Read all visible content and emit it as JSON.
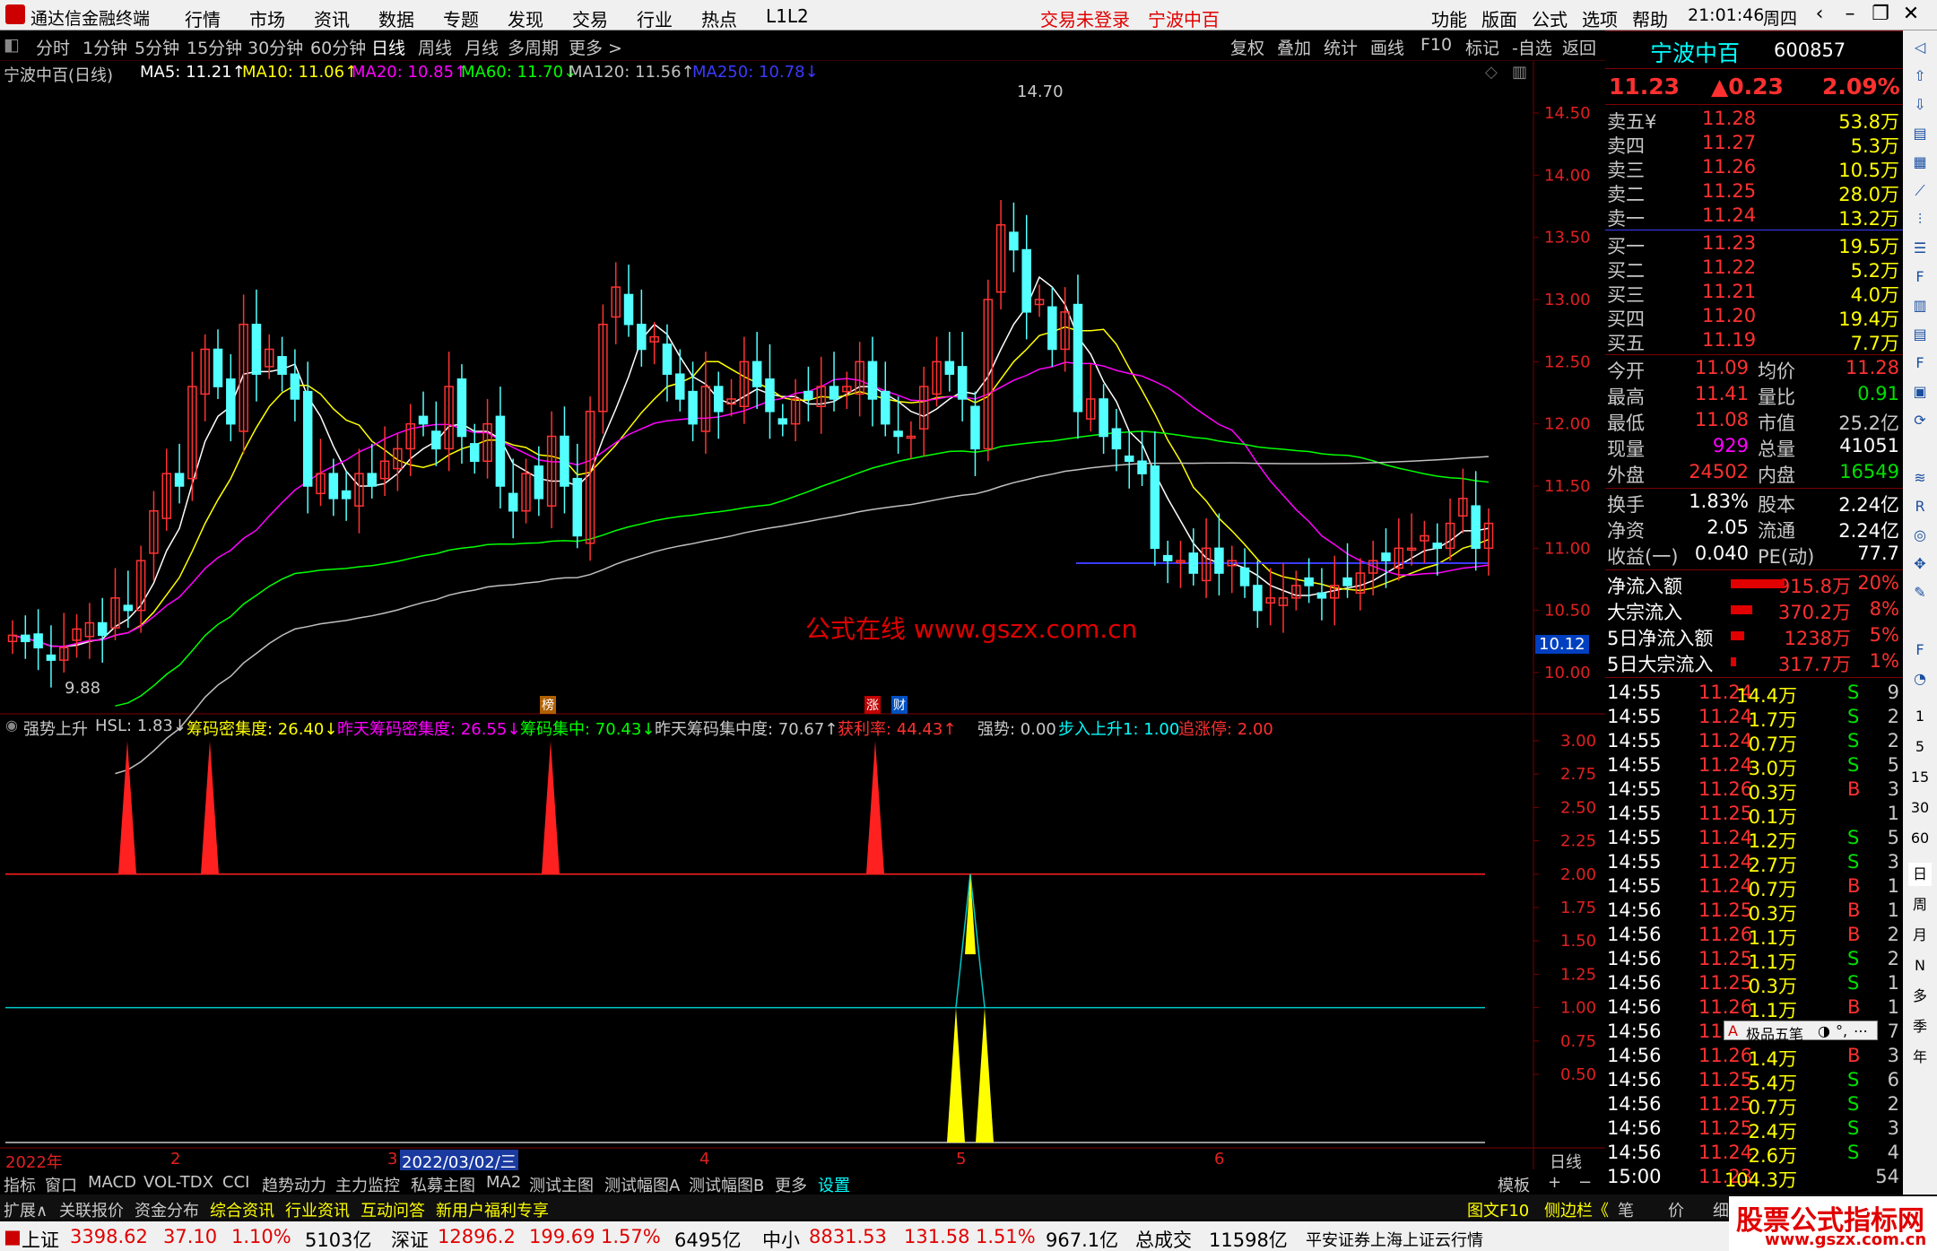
{
  "app": {
    "title": "通达信金融终端",
    "menu": [
      "行情",
      "市场",
      "资讯",
      "数据",
      "专题",
      "发现",
      "交易",
      "行业",
      "热点",
      "L1L2"
    ],
    "status_login": "交易未登录",
    "status_stock": "宁波中百",
    "right_menu": [
      "功能",
      "版面",
      "公式",
      "选项",
      "帮助"
    ],
    "clock": "21:01:46",
    "weekday": "周四"
  },
  "periods": [
    "分时",
    "1分钟",
    "5分钟",
    "15分钟",
    "30分钟",
    "60分钟",
    "日线",
    "周线",
    "月线",
    "多周期",
    "更多 >"
  ],
  "active_period": "日线",
  "toolbar_right": [
    "复权",
    "叠加",
    "统计",
    "画线",
    "F10",
    "标记",
    "-自选",
    "返回"
  ],
  "main_chart": {
    "stock_label": "宁波中百(日线)",
    "ma": [
      {
        "label": "MA5: 11.21↑",
        "color": "#ffffff"
      },
      {
        "label": "MA10: 11.06↑",
        "color": "#ffff00"
      },
      {
        "label": "MA20: 10.85↑",
        "color": "#ff00ff"
      },
      {
        "label": "MA60: 11.70↓",
        "color": "#00ff00"
      },
      {
        "label": "MA120: 11.56↑",
        "color": "#c0c0c0"
      },
      {
        "label": "MA250: 10.78↓",
        "color": "#3a3aff"
      }
    ],
    "y_ticks": [
      "14.50",
      "14.00",
      "13.50",
      "13.00",
      "12.50",
      "12.00",
      "11.50",
      "11.00",
      "10.50",
      "10.00"
    ],
    "high_label": "14.70",
    "low_label": "9.88",
    "current_price_tag": "10.12",
    "watermark": "公式在线  www.gszx.com.cn",
    "markers": [
      "榜",
      "涨",
      "财"
    ]
  },
  "indicator": {
    "name": "强势上升",
    "items": [
      {
        "label": "HSL: 1.83↓",
        "color": "#c8c8c8"
      },
      {
        "label": "筹码密集度: 26.40↓",
        "color": "#ffff00"
      },
      {
        "label": "昨天筹码密集度: 26.55↓",
        "color": "#ff00ff"
      },
      {
        "label": "筹码集中: 70.43↓",
        "color": "#00ff00"
      },
      {
        "label": "昨天筹码集中度: 70.67↑",
        "color": "#c8c8c8"
      },
      {
        "label": "获利率: 44.43↑",
        "color": "#ff3030"
      },
      {
        "label": "强势: 0.00",
        "color": "#c8c8c8"
      },
      {
        "label": "步入上升1: 1.00",
        "color": "#00ffff"
      },
      {
        "label": "追涨停: 2.00",
        "color": "#ff3030"
      }
    ],
    "y_ticks": [
      "3.00",
      "2.75",
      "2.50",
      "2.25",
      "2.00",
      "1.75",
      "1.50",
      "1.25",
      "1.00",
      "0.75",
      "0.50"
    ]
  },
  "x_axis": {
    "labels": [
      "2022年",
      "2",
      "3",
      "2022/03/02/三",
      "4",
      "5",
      "6"
    ],
    "period_tag": "日线"
  },
  "quote": {
    "name": "宁波中百",
    "code": "600857",
    "price": "11.23",
    "change": "▲0.23",
    "pct": "2.09%",
    "asks": [
      {
        "label": "卖五¥",
        "price": "11.28",
        "vol": "53.8万"
      },
      {
        "label": "卖四",
        "price": "11.27",
        "vol": "5.3万"
      },
      {
        "label": "卖三",
        "price": "11.26",
        "vol": "10.5万"
      },
      {
        "label": "卖二",
        "price": "11.25",
        "vol": "28.0万"
      },
      {
        "label": "卖一",
        "price": "11.24",
        "vol": "13.2万"
      }
    ],
    "bids": [
      {
        "label": "买一",
        "price": "11.23",
        "vol": "19.5万"
      },
      {
        "label": "买二",
        "price": "11.22",
        "vol": "5.2万"
      },
      {
        "label": "买三",
        "price": "11.21",
        "vol": "4.0万"
      },
      {
        "label": "买四",
        "price": "11.20",
        "vol": "19.4万"
      },
      {
        "label": "买五",
        "price": "11.19",
        "vol": "7.7万"
      }
    ],
    "stats": [
      {
        "l1": "今开",
        "v1": "11.09",
        "c1": "#ff3030",
        "l2": "均价",
        "v2": "11.28",
        "c2": "#ff3030"
      },
      {
        "l1": "最高",
        "v1": "11.41",
        "c1": "#ff3030",
        "l2": "量比",
        "v2": "0.91",
        "c2": "#00e000"
      },
      {
        "l1": "最低",
        "v1": "11.08",
        "c1": "#ff3030",
        "l2": "市值",
        "v2": "25.2亿",
        "c2": "#c8c8c8"
      },
      {
        "l1": "现量",
        "v1": "929",
        "c1": "#ff00ff",
        "l2": "总量",
        "v2": "41051",
        "c2": "#ffffff"
      },
      {
        "l1": "外盘",
        "v1": "24502",
        "c1": "#ff3030",
        "l2": "内盘",
        "v2": "16549",
        "c2": "#00e000"
      },
      {
        "l1": "换手",
        "v1": "1.83%",
        "c1": "#ffffff",
        "l2": "股本",
        "v2": "2.24亿",
        "c2": "#ffffff"
      },
      {
        "l1": "净资",
        "v1": "2.05",
        "c1": "#ffffff",
        "l2": "流通",
        "v2": "2.24亿",
        "c2": "#ffffff"
      },
      {
        "l1": "收益(一)",
        "v1": "0.040",
        "c1": "#ffffff",
        "l2": "PE(动)",
        "v2": "77.7",
        "c2": "#ffffff"
      }
    ],
    "flows": [
      {
        "label": "净流入额",
        "value": "915.8万",
        "pct": "20%",
        "bar": 0.2
      },
      {
        "label": "大宗流入",
        "value": "370.2万",
        "pct": "8%",
        "bar": 0.08
      },
      {
        "label": "5日净流入额",
        "value": "1238万",
        "pct": "5%",
        "bar": 0.05
      },
      {
        "label": "5日大宗流入",
        "value": "317.7万",
        "pct": "1%",
        "bar": 0.01
      }
    ],
    "ticks": [
      {
        "t": "14:55",
        "p": "11.24",
        "v": "14.4万",
        "d": "S",
        "n": "9"
      },
      {
        "t": "14:55",
        "p": "11.24",
        "v": "1.7万",
        "d": "S",
        "n": "2"
      },
      {
        "t": "14:55",
        "p": "11.24",
        "v": "0.7万",
        "d": "S",
        "n": "2"
      },
      {
        "t": "14:55",
        "p": "11.24",
        "v": "3.0万",
        "d": "S",
        "n": "5"
      },
      {
        "t": "14:55",
        "p": "11.26",
        "v": "0.3万",
        "d": "B",
        "n": "3"
      },
      {
        "t": "14:55",
        "p": "11.25",
        "v": "0.1万",
        "d": "",
        "n": "1"
      },
      {
        "t": "14:55",
        "p": "11.24",
        "v": "1.2万",
        "d": "S",
        "n": "5"
      },
      {
        "t": "14:55",
        "p": "11.24",
        "v": "2.7万",
        "d": "S",
        "n": "3"
      },
      {
        "t": "14:55",
        "p": "11.24",
        "v": "0.7万",
        "d": "B",
        "n": "1"
      },
      {
        "t": "14:56",
        "p": "11.25",
        "v": "0.3万",
        "d": "B",
        "n": "1"
      },
      {
        "t": "14:56",
        "p": "11.26",
        "v": "1.1万",
        "d": "B",
        "n": "2"
      },
      {
        "t": "14:56",
        "p": "11.25",
        "v": "1.1万",
        "d": "S",
        "n": "2"
      },
      {
        "t": "14:56",
        "p": "11.25",
        "v": "0.3万",
        "d": "S",
        "n": "1"
      },
      {
        "t": "14:56",
        "p": "11.26",
        "v": "1.1万",
        "d": "B",
        "n": "1"
      },
      {
        "t": "14:56",
        "p": "11",
        "v": "",
        "d": "",
        "n": "7"
      },
      {
        "t": "14:56",
        "p": "11.26",
        "v": "1.4万",
        "d": "B",
        "n": "3"
      },
      {
        "t": "14:56",
        "p": "11.25",
        "v": "5.4万",
        "d": "S",
        "n": "6"
      },
      {
        "t": "14:56",
        "p": "11.25",
        "v": "0.7万",
        "d": "S",
        "n": "2"
      },
      {
        "t": "14:56",
        "p": "11.25",
        "v": "2.4万",
        "d": "S",
        "n": "3"
      },
      {
        "t": "14:56",
        "p": "11.24",
        "v": "2.6万",
        "d": "S",
        "n": "4"
      },
      {
        "t": "15:00",
        "p": "11.23",
        "v": "104.3万",
        "d": "",
        "n": "54"
      }
    ],
    "popup": "极品五笔"
  },
  "side_icons": [
    "1",
    "5",
    "15",
    "30",
    "60",
    "日",
    "周",
    "月",
    "N",
    "多",
    "季",
    "年"
  ],
  "tabs_row1": [
    "指标",
    "窗口",
    "MACD",
    "VOL-TDX",
    "CCI",
    "趋势动力",
    "主力监控",
    "私募主图",
    "MA2",
    "测试主图",
    "测试幅图A",
    "测试幅图B",
    "更多",
    "设置"
  ],
  "tabs_row1_right": [
    "模板",
    "+",
    "−"
  ],
  "tabs_row2": [
    "扩展∧",
    "关联报价",
    "资金分布",
    "综合资讯",
    "行业资讯",
    "互动问答",
    "新用户福利专享"
  ],
  "tabs_row2_right": [
    "图文F10",
    "侧边栏《",
    "笔",
    "价",
    "细",
    "势"
  ],
  "index_bar": {
    "sh_label": "上证",
    "sh_val": "3398.62",
    "sh_chg": "37.10",
    "sh_pct": "1.10%",
    "sh_amt": "5103亿",
    "sz_label": "深证",
    "sz_val": "12896.2",
    "sz_chg": "199.69",
    "sz_pct": "1.57%",
    "sz_amt": "6495亿",
    "zx_label": "中小",
    "zx_val": "8831.53",
    "zx_chg": "131.58",
    "zx_pct": "1.51%",
    "zx_amt": "967.1亿",
    "total_label": "总成交",
    "total_val": "11598亿",
    "cloud": "平安证券上海上证云行情"
  },
  "brand": {
    "line1": "股票公式指标网",
    "line2": "www.gszx.com.cn"
  }
}
